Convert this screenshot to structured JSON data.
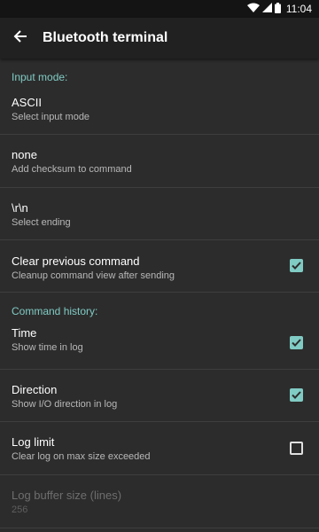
{
  "status": {
    "time": "11:04"
  },
  "appbar": {
    "title": "Bluetooth terminal"
  },
  "sections": {
    "input_mode": "Input mode:",
    "history": "Command history:"
  },
  "prefs": {
    "ascii": {
      "title": "ASCII",
      "summary": "Select input mode"
    },
    "checksum": {
      "title": "none",
      "summary": "Add checksum to command"
    },
    "ending": {
      "title": "\\r\\n",
      "summary": "Select ending"
    },
    "clear": {
      "title": "Clear previous command",
      "summary": "Cleanup command view after sending",
      "checked": true
    },
    "time": {
      "title": "Time",
      "summary": "Show time in log",
      "checked": true
    },
    "direction": {
      "title": "Direction",
      "summary": "Show I/O direction in log",
      "checked": true
    },
    "loglimit": {
      "title": "Log limit",
      "summary": "Clear log on max size exceeded",
      "checked": false
    },
    "buffer": {
      "title": "Log buffer size (lines)",
      "summary": "256",
      "enabled": false
    }
  },
  "colors": {
    "accent": "#80cbc4",
    "background": "#2c2c2c",
    "appbar": "#212121",
    "statusbar": "#141414"
  }
}
